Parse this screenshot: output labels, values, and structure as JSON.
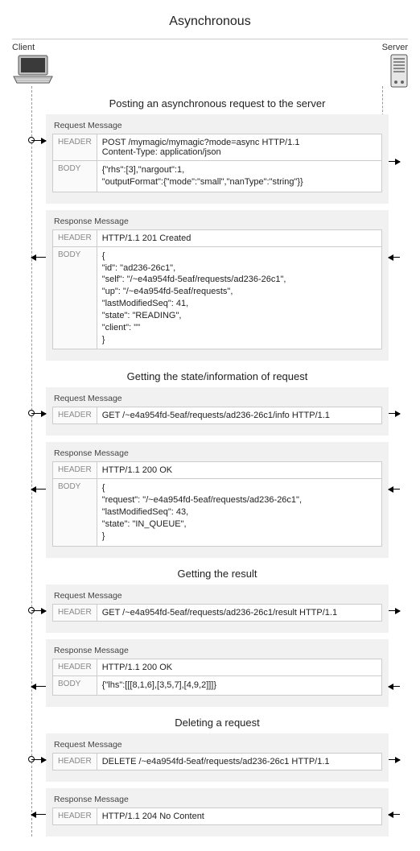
{
  "title": "Asynchronous",
  "lane_client": "Client",
  "lane_server": "Server",
  "label_header": "HEADER",
  "label_body": "BODY",
  "caption_request": "Request Message",
  "caption_response": "Response Message",
  "sections": [
    {
      "heading": "Posting an asynchronous request to the server",
      "request": {
        "header": "POST /mymagic/mymagic?mode=async HTTP/1.1\nContent-Type: application/json",
        "body": "{\"rhs\":[3],\"nargout\":1,\n\"outputFormat\":{\"mode\":\"small\",\"nanType\":\"string\"}}"
      },
      "response": {
        "header": "HTTP/1.1 201 Created",
        "body": "{\n\"id\": \"ad236-26c1\",\n\"self\": \"/~e4a954fd-5eaf/requests/ad236-26c1\",\n\"up\": \"/~e4a954fd-5eaf/requests\",\n\"lastModifiedSeq\": 41,\n\"state\": \"READING\",\n\"client\": \"\"\n}"
      }
    },
    {
      "heading": "Getting the state/information of request",
      "request": {
        "header": "GET /~e4a954fd-5eaf/requests/ad236-26c1/info HTTP/1.1",
        "body": null
      },
      "response": {
        "header": "HTTP/1.1 200 OK",
        "body": "{\n\"request\": \"/~e4a954fd-5eaf/requests/ad236-26c1\",\n\"lastModifiedSeq\": 43,\n\"state\": \"IN_QUEUE\",\n}"
      }
    },
    {
      "heading": "Getting the result",
      "request": {
        "header": "GET /~e4a954fd-5eaf/requests/ad236-26c1/result HTTP/1.1",
        "body": null
      },
      "response": {
        "header": "HTTP/1.1 200 OK",
        "body": "{\"lhs\":[[[8,1,6],[3,5,7],[4,9,2]]]}"
      }
    },
    {
      "heading": "Deleting a request",
      "request": {
        "header": "DELETE /~e4a954fd-5eaf/requests/ad236-26c1 HTTP/1.1",
        "body": null
      },
      "response": {
        "header": "HTTP/1.1 204 No Content",
        "body": null
      }
    }
  ]
}
